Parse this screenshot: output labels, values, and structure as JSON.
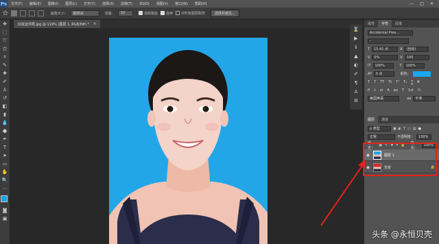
{
  "app": {
    "logo": "Ps"
  },
  "menubar": {
    "items": [
      "文件(F)",
      "编辑(E)",
      "图像(I)",
      "图层(L)",
      "文字(Y)",
      "选择(S)",
      "滤镜(T)",
      "3D(D)",
      "视图(V)",
      "窗口(W)",
      "帮助(H)"
    ],
    "window_controls": [
      "—",
      "□",
      "✕"
    ]
  },
  "options": {
    "brush_size_label": "画笔大小：",
    "brush_size_value": "取样点",
    "tolerance_label": "容差：",
    "tolerance_value": "32",
    "antialias_label": "消除锯齿",
    "contiguous_label": "连续",
    "all_layers_label": "对所有图层取样",
    "select_subject_label": "选择并遮住..."
  },
  "document": {
    "tab_title": "红底证件照.jpg @ 119% (图层 1, RGB/8#) *",
    "close": "×"
  },
  "character_panel": {
    "tabs": [
      "属性",
      "字符",
      "段落"
    ],
    "font_family": "Accidental Pres...",
    "font_style": "-",
    "font_size": "15.41 点",
    "leading": "(自动)",
    "kerning": "0%",
    "tracking": "100",
    "vertical_scale": "100%",
    "horizontal_scale": "100%",
    "baseline_shift": "0 点",
    "color_label": "颜色：",
    "color": "#18a8f0",
    "language": "美国英语",
    "antialias": "平滑",
    "aa_prefix": "aa"
  },
  "layers_panel": {
    "tabs": [
      "图层",
      "通道"
    ],
    "filter_label": "ρ 类型",
    "blend_mode": "正常",
    "opacity_label": "不透明度：",
    "opacity_value": "100%",
    "lock_label": "锁定：",
    "fill_label": "填充：",
    "fill_value": "100%",
    "layers": [
      {
        "name": "图层 1",
        "visible": true
      },
      {
        "name": "背景",
        "visible": true,
        "locked": true
      }
    ]
  },
  "watermark": "头条 @永恒贝壳",
  "colors": {
    "accent_highlight": "#e2231a",
    "canvas_bg": "#23a6e8"
  }
}
